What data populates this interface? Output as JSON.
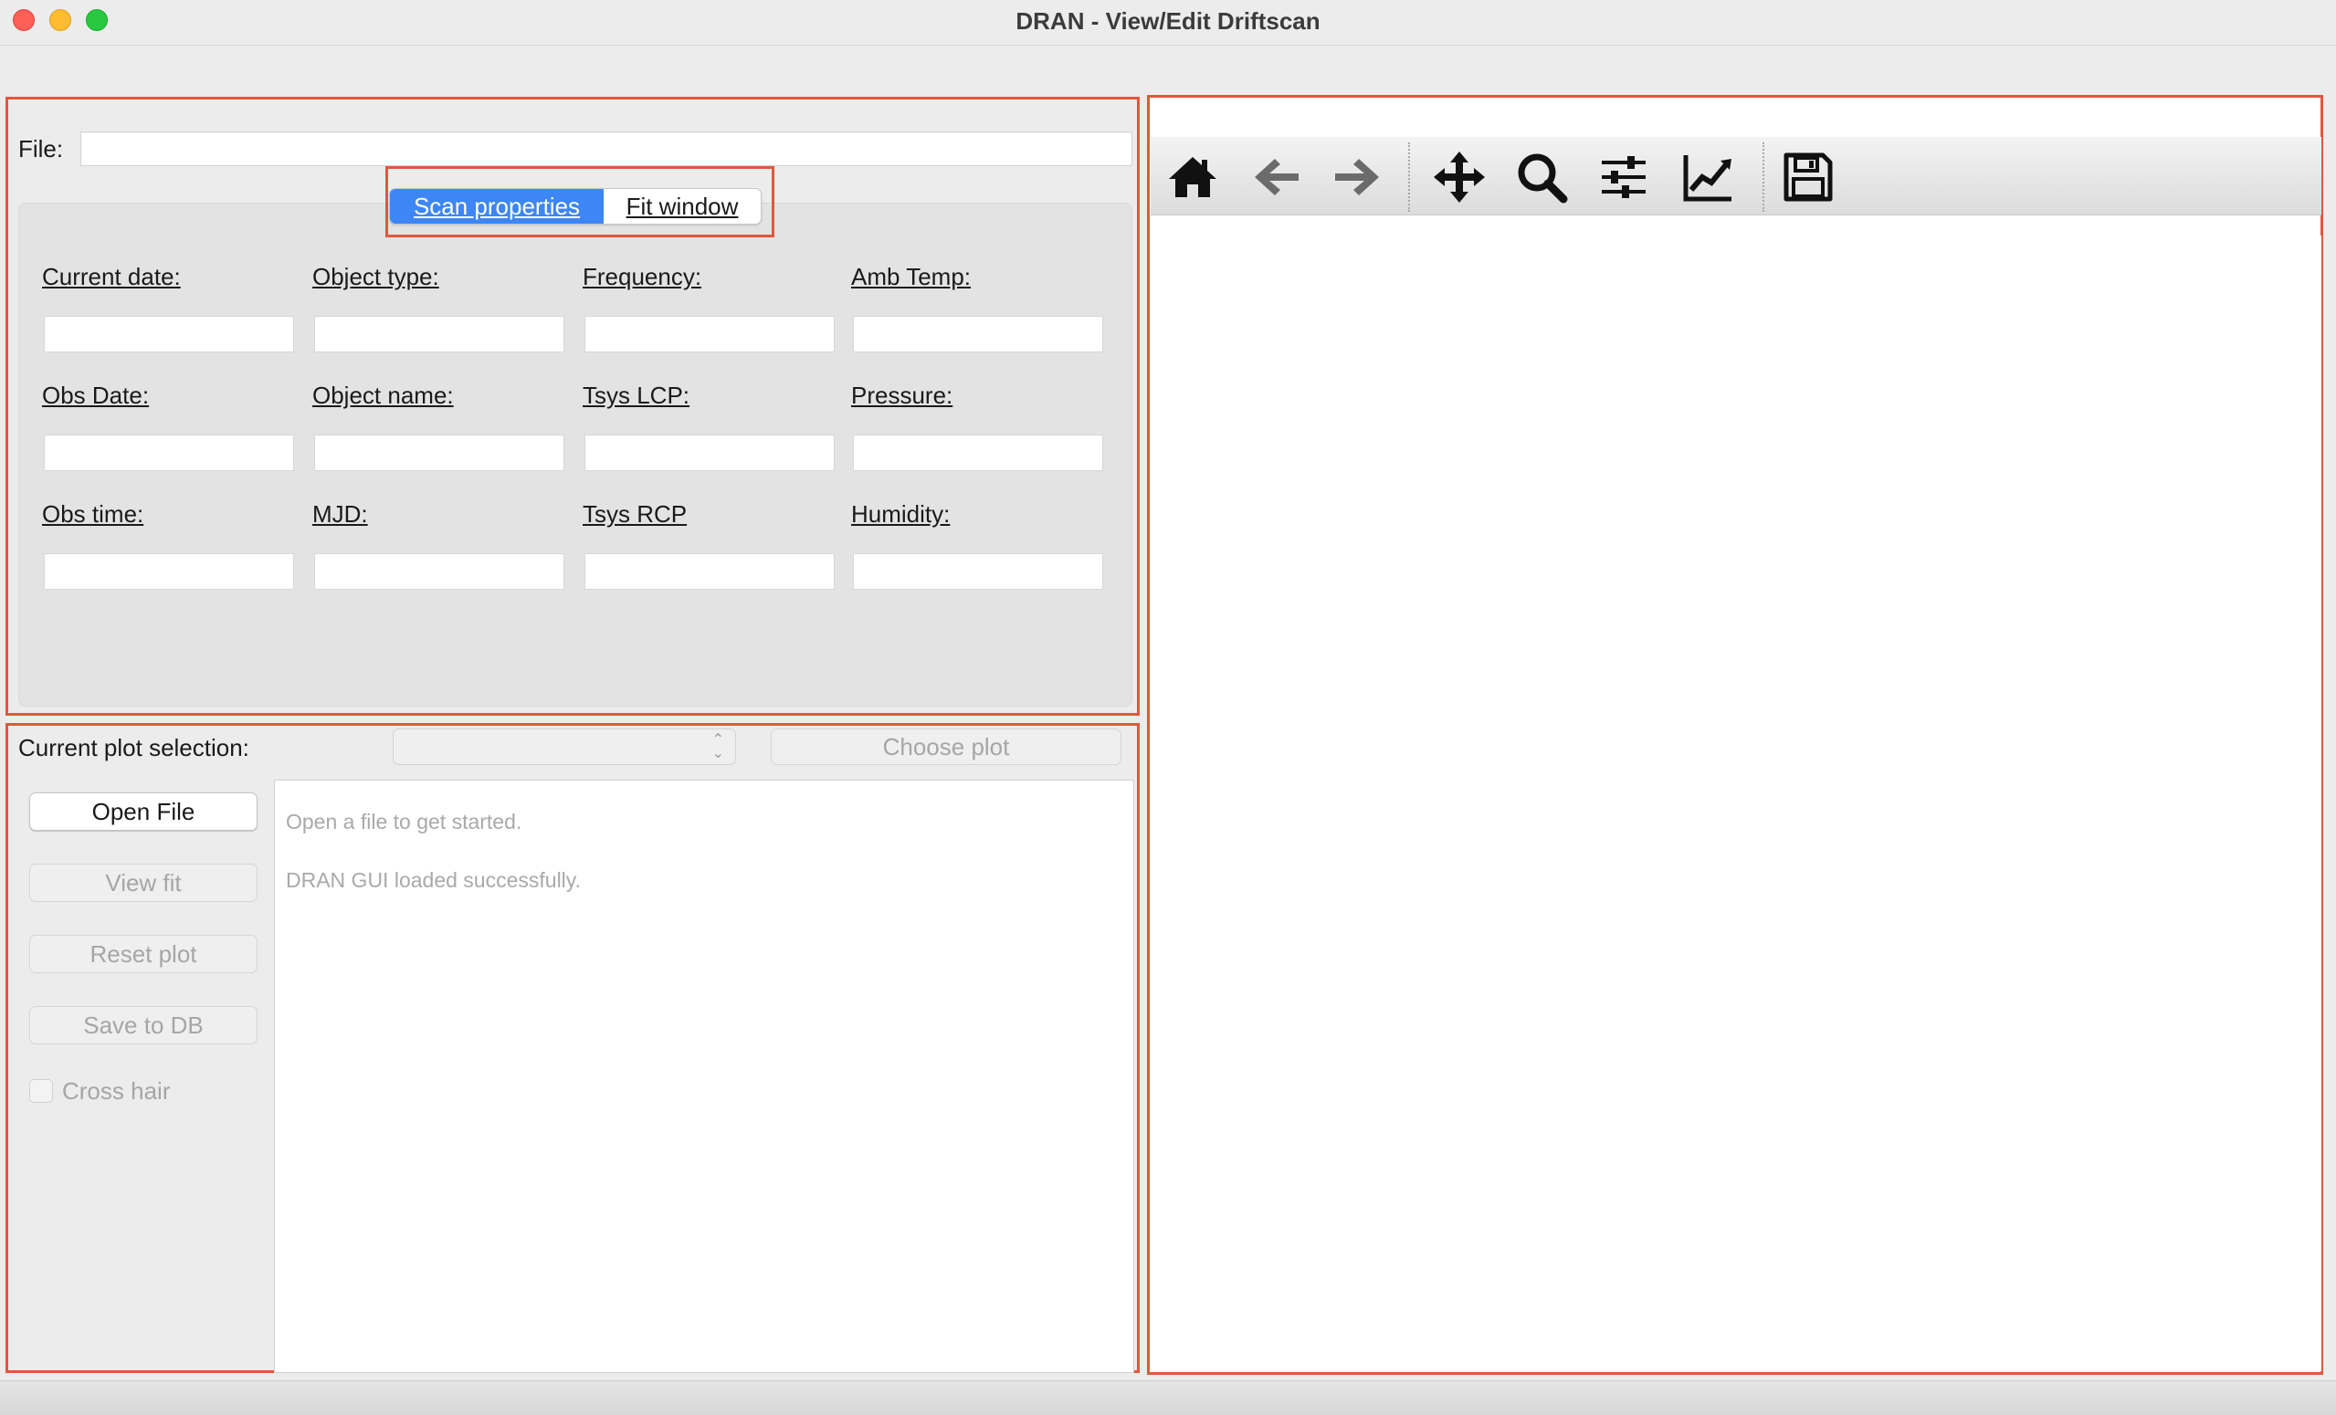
{
  "window": {
    "title": "DRAN - View/Edit Driftscan"
  },
  "file_row": {
    "label": "File:",
    "value": ""
  },
  "tabs": [
    {
      "label": "Scan properties",
      "active": true
    },
    {
      "label": "Fit window",
      "active": false
    }
  ],
  "scan_properties": {
    "fields": [
      {
        "label": "Current date:",
        "value": ""
      },
      {
        "label": "Object type:",
        "value": ""
      },
      {
        "label": "Frequency:",
        "value": ""
      },
      {
        "label": "Amb Temp:",
        "value": ""
      },
      {
        "label": "Obs Date:",
        "value": ""
      },
      {
        "label": "Object name:",
        "value": ""
      },
      {
        "label": "Tsys LCP:",
        "value": ""
      },
      {
        "label": "Pressure:",
        "value": ""
      },
      {
        "label": "Obs time:",
        "value": ""
      },
      {
        "label": "MJD:",
        "value": ""
      },
      {
        "label": "Tsys RCP",
        "value": ""
      },
      {
        "label": "Humidity:",
        "value": ""
      }
    ]
  },
  "plot_controls": {
    "selection_label": "Current plot selection:",
    "selection_value": "",
    "choose_plot_label": "Choose plot",
    "open_file_label": "Open File",
    "view_fit_label": "View fit",
    "reset_plot_label": "Reset plot",
    "save_to_db_label": "Save to DB",
    "cross_hair_label": "Cross hair",
    "cross_hair_checked": false
  },
  "log": {
    "lines": [
      "Open a file to get started.",
      "DRAN GUI loaded successfully."
    ]
  },
  "plot_toolbar": {
    "icons": [
      "home-icon",
      "back-arrow-icon",
      "forward-arrow-icon",
      "pan-icon",
      "zoom-icon",
      "configure-subplots-icon",
      "edit-axis-icon",
      "save-icon"
    ]
  },
  "colors": {
    "accent": "#3d86f5",
    "highlight_frame": "#e2573b",
    "window_background": "#ececec"
  }
}
